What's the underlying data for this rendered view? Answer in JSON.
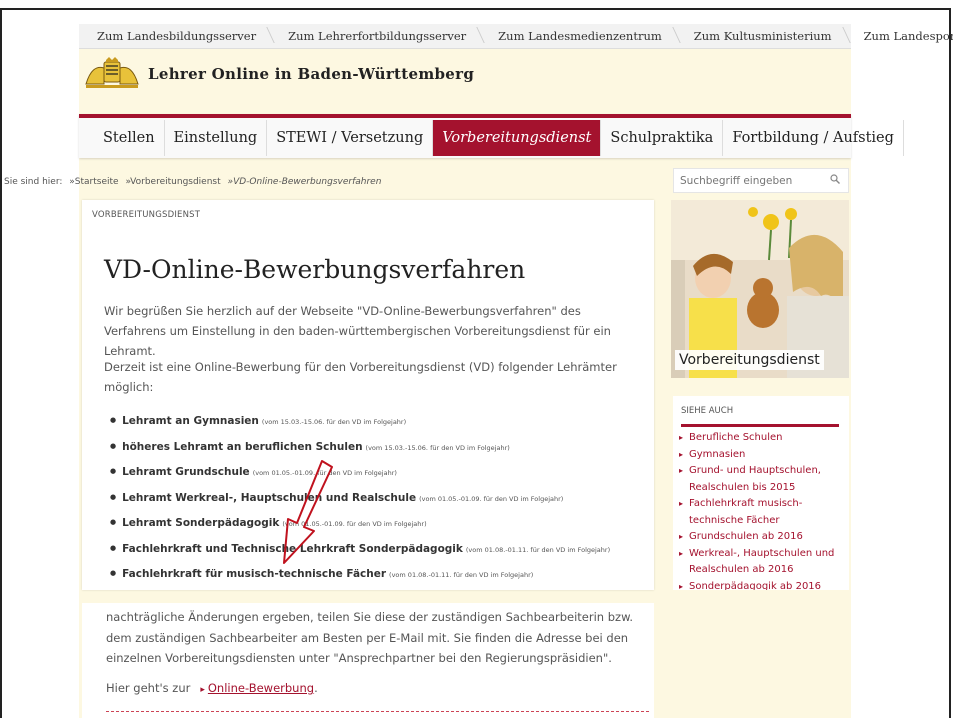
{
  "top_links": [
    "Zum Landesbildungsserver",
    "Zum Lehrerfortbildungsserver",
    "Zum Landesmedienzentrum",
    "Zum Kultusministerium",
    "Zum Landesportal"
  ],
  "site_title": "Lehrer Online in Baden-Württemberg",
  "main_nav": [
    {
      "label": "Stellen",
      "active": false
    },
    {
      "label": "Einstellung",
      "active": false
    },
    {
      "label": "STEWI / Versetzung",
      "active": false
    },
    {
      "label": "Vorbereitungsdienst",
      "active": true
    },
    {
      "label": "Schulpraktika",
      "active": false
    },
    {
      "label": "Fortbildung / Aufstieg",
      "active": false
    }
  ],
  "breadcrumb": {
    "prefix": "Sie sind hier:",
    "items": [
      "»Startseite",
      "»Vorbereitungsdienst",
      "»VD-Online-Bewerbungsverfahren"
    ]
  },
  "search": {
    "placeholder": "Suchbegriff eingeben",
    "icon": "search-icon"
  },
  "content": {
    "kicker": "VORBEREITUNGSDIENST",
    "title": "VD-Online-Bewerbungsverfahren",
    "intro": "Wir begrüßen Sie herzlich auf der Webseite \"VD-Online-Bewerbungsverfahren\" des Verfahrens um Einstellung in den baden-württembergischen Vorbereitungsdienst für ein Lehramt.",
    "intro2": "Derzeit ist eine Online-Bewerbung für den Vorbereitungsdienst (VD) folgender Lehrämter möglich:",
    "list": [
      {
        "name": "Lehramt an Gymnasien",
        "note": "(vom 15.03.-15.06. für den VD im Folgejahr)"
      },
      {
        "name": "höheres Lehramt an beruflichen Schulen",
        "note": "(vom 15.03.-15.06. für den VD im Folgejahr)"
      },
      {
        "name": "Lehramt Grundschule",
        "note": "(vom 01.05.-01.09. für den VD im Folgejahr)"
      },
      {
        "name": "Lehramt Werkreal-, Hauptschulen und Realschule",
        "note": "(vom 01.05.-01.09. für den VD im Folgejahr)"
      },
      {
        "name": "Lehramt Sonderpädagogik",
        "note": "(vom 01.05.-01.09. für den VD im Folgejahr)"
      },
      {
        "name": "Fachlehrkraft und Technische Lehrkraft Sonderpädagogik",
        "note": "(vom 01.08.-01.11. für den VD im Folgejahr)"
      },
      {
        "name": "Fachlehrkraft für musisch-technische Fächer",
        "note": "(vom 01.08.-01.11. für den VD im Folgejahr)"
      }
    ],
    "lower_text": "nachträgliche Änderungen ergeben, teilen Sie diese der zuständigen Sachbearbeiterin bzw. dem zuständigen Sachbearbeiter am Besten per E-Mail mit. Sie finden die Adresse bei den einzelnen Vorbereitungsdiensten unter \"Ansprechpartner bei den Regierungspräsidien\".",
    "go_prefix": "Hier geht's zur",
    "go_link": "Online-Bewerbung"
  },
  "sidebar": {
    "image_caption": "Vorbereitungsdienst",
    "see_also_title": "SIEHE AUCH",
    "links": [
      "Berufliche Schulen",
      "Gymnasien",
      "Grund- und Hauptschulen, Realschulen bis 2015",
      "Fachlehrkraft musisch-technische Fächer",
      "Grundschulen ab 2016",
      "Werkreal-, Hauptschulen und Realschulen ab 2016",
      "Sonderpädagogik ab 2016"
    ]
  },
  "colors": {
    "accent": "#a4122e",
    "background": "#fdf8e1"
  }
}
